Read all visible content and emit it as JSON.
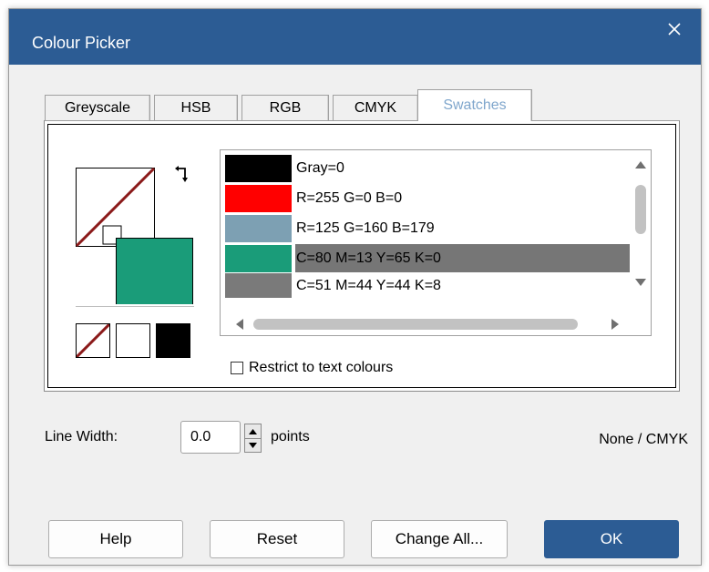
{
  "window": {
    "title": "Colour Picker",
    "close_icon": "close-icon"
  },
  "tabs": [
    {
      "label": "Greyscale",
      "active": false
    },
    {
      "label": "HSB",
      "active": false
    },
    {
      "label": "RGB",
      "active": false
    },
    {
      "label": "CMYK",
      "active": false
    },
    {
      "label": "Swatches",
      "active": true
    }
  ],
  "preview": {
    "fill_color": "#1a9c79",
    "line_color_state": "none",
    "swap_icon": "swap-arrows-icon",
    "quick": [
      {
        "name": "none",
        "icon": "none-swatch-icon"
      },
      {
        "name": "white",
        "color": "#ffffff"
      },
      {
        "name": "black",
        "color": "#000000"
      }
    ]
  },
  "swatches": [
    {
      "label": "Gray=0",
      "color": "#000000",
      "selected": false
    },
    {
      "label": "R=255 G=0 B=0",
      "color": "#ff0000",
      "selected": false
    },
    {
      "label": "R=125 G=160 B=179",
      "color": "#7da0b3",
      "selected": false
    },
    {
      "label": "C=80 M=13 Y=65 K=0",
      "color": "#1a9c79",
      "selected": true
    },
    {
      "label": "C=51 M=44 Y=44 K=8",
      "color": "#7a7a7a",
      "selected": false
    }
  ],
  "restrict_checkbox": {
    "label": "Restrict to text colours",
    "checked": false
  },
  "line_width": {
    "label": "Line Width:",
    "value": "0.0",
    "unit": "points"
  },
  "mode_text": "None / CMYK",
  "buttons": {
    "help": "Help",
    "reset": "Reset",
    "change_all": "Change All...",
    "ok": "OK"
  },
  "colors": {
    "accent": "#2c5c94",
    "active_tab_text": "#7fa6cc",
    "selection": "#767676"
  }
}
